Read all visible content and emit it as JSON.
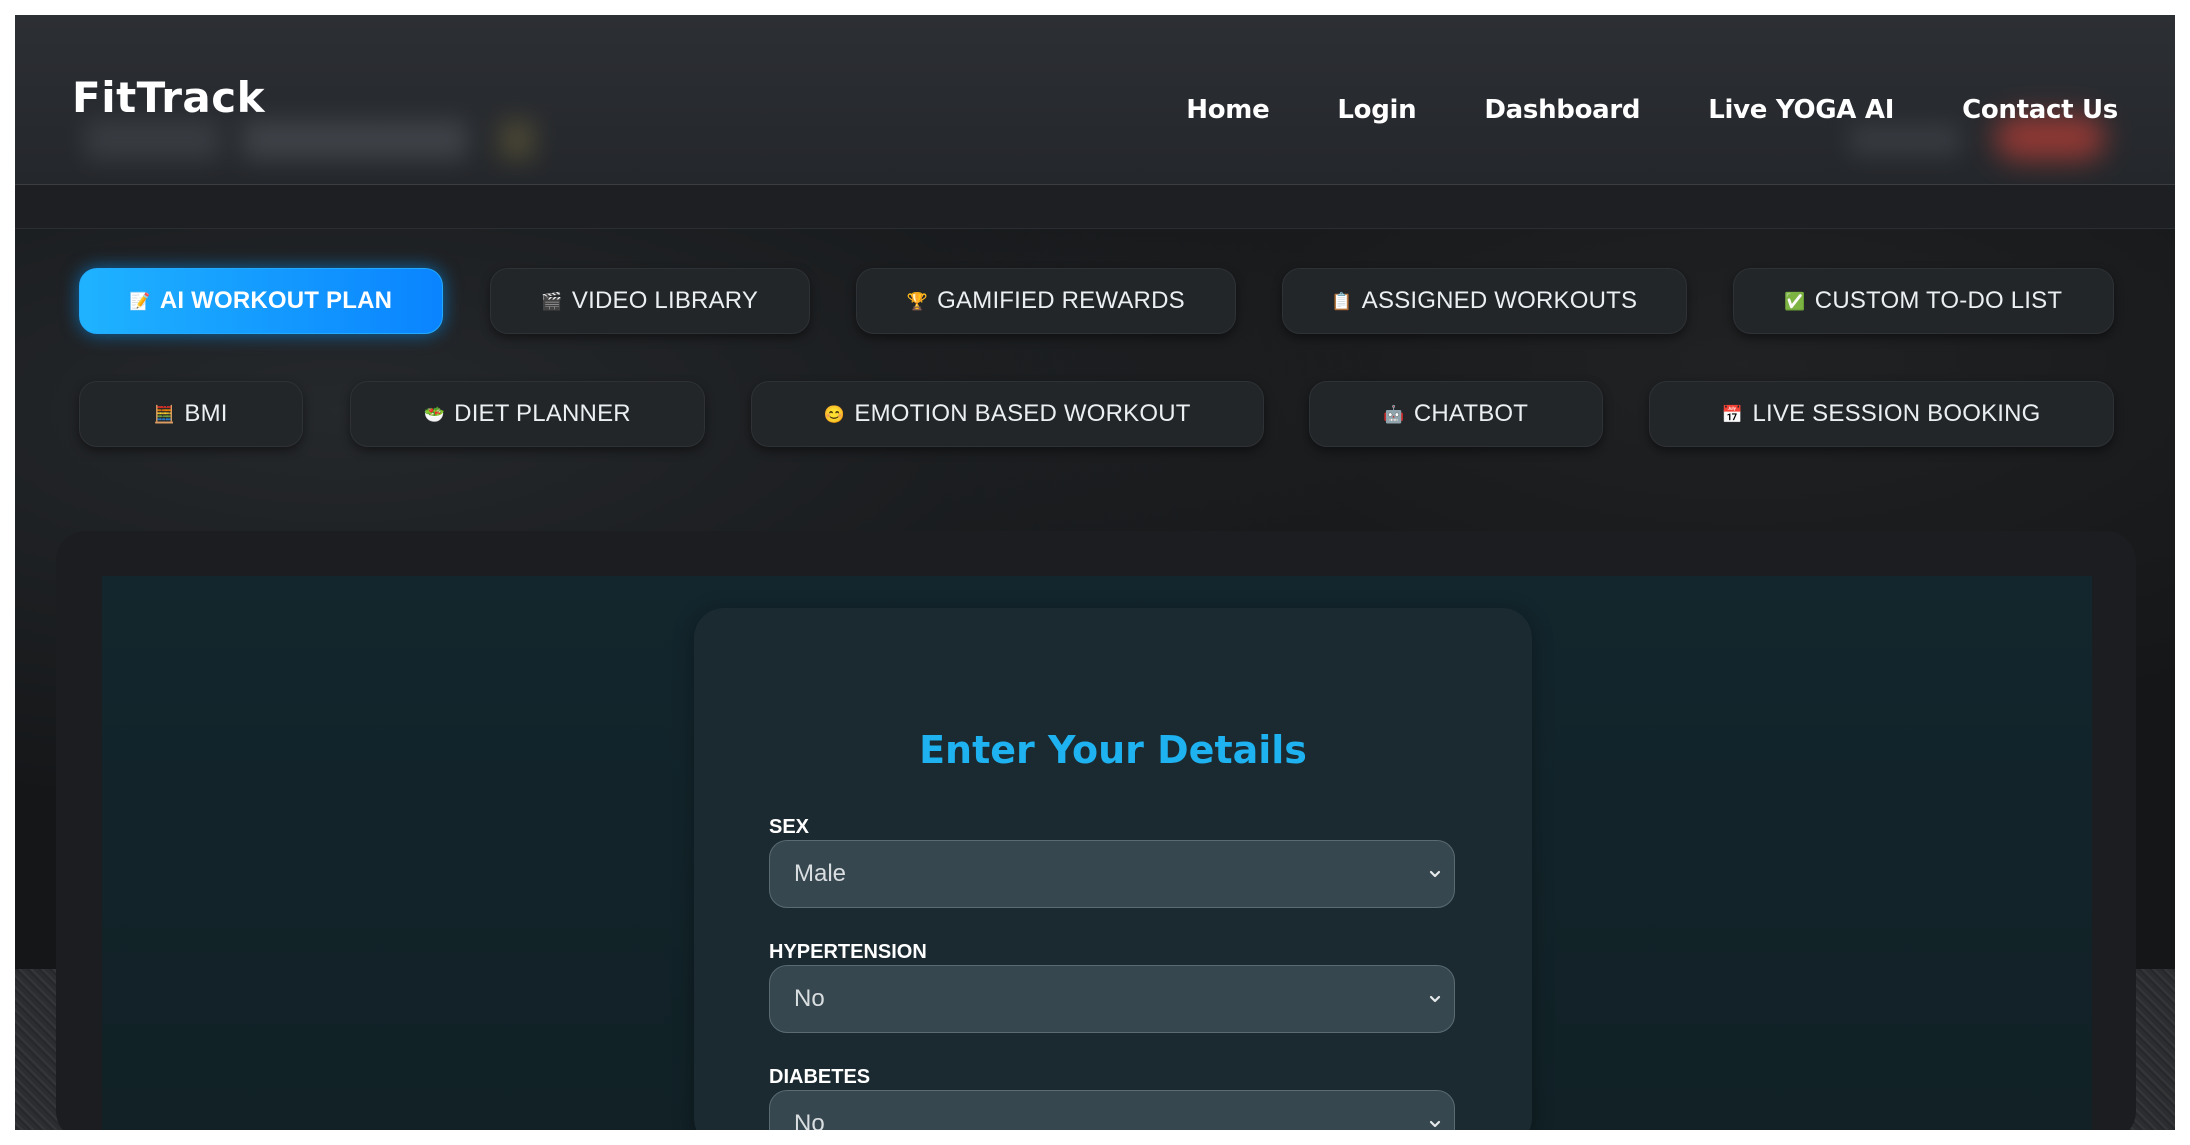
{
  "brand": {
    "name": "FitTrack"
  },
  "nav": {
    "links": [
      "Home",
      "Login",
      "Dashboard",
      "Live YOGA AI",
      "Contact Us"
    ]
  },
  "feature_tabs": {
    "row1": [
      {
        "icon": "memo-icon",
        "glyph": "📝",
        "label": "AI WORKOUT PLAN",
        "active": true
      },
      {
        "icon": "clapper-icon",
        "glyph": "🎬",
        "label": "VIDEO LIBRARY"
      },
      {
        "icon": "trophy-icon",
        "glyph": "🏆",
        "label": "GAMIFIED REWARDS"
      },
      {
        "icon": "clipboard-icon",
        "glyph": "📋",
        "label": "ASSIGNED WORKOUTS"
      },
      {
        "icon": "check-icon",
        "glyph": "✅",
        "label": "CUSTOM TO-DO LIST"
      }
    ],
    "row2": [
      {
        "icon": "abacus-icon",
        "glyph": "🧮",
        "label": "BMI"
      },
      {
        "icon": "salad-icon",
        "glyph": "🥗",
        "label": "DIET PLANNER"
      },
      {
        "icon": "smile-icon",
        "glyph": "😊",
        "label": "EMOTION BASED WORKOUT"
      },
      {
        "icon": "robot-icon",
        "glyph": "🤖",
        "label": "CHATBOT"
      },
      {
        "icon": "calendar-icon",
        "glyph": "📅",
        "label": "LIVE SESSION BOOKING"
      }
    ]
  },
  "form": {
    "title": "Enter Your Details",
    "fields": [
      {
        "label": "SEX",
        "value": "Male"
      },
      {
        "label": "HYPERTENSION",
        "value": "No"
      },
      {
        "label": "DIABETES",
        "value": "No"
      }
    ]
  },
  "colors": {
    "accent": "#1EB2F0",
    "active_tab_start": "#1FB3FF",
    "active_tab_end": "#0A84FF",
    "nav_bg": "#2C2F34",
    "card_bg": "#1B2A31"
  }
}
